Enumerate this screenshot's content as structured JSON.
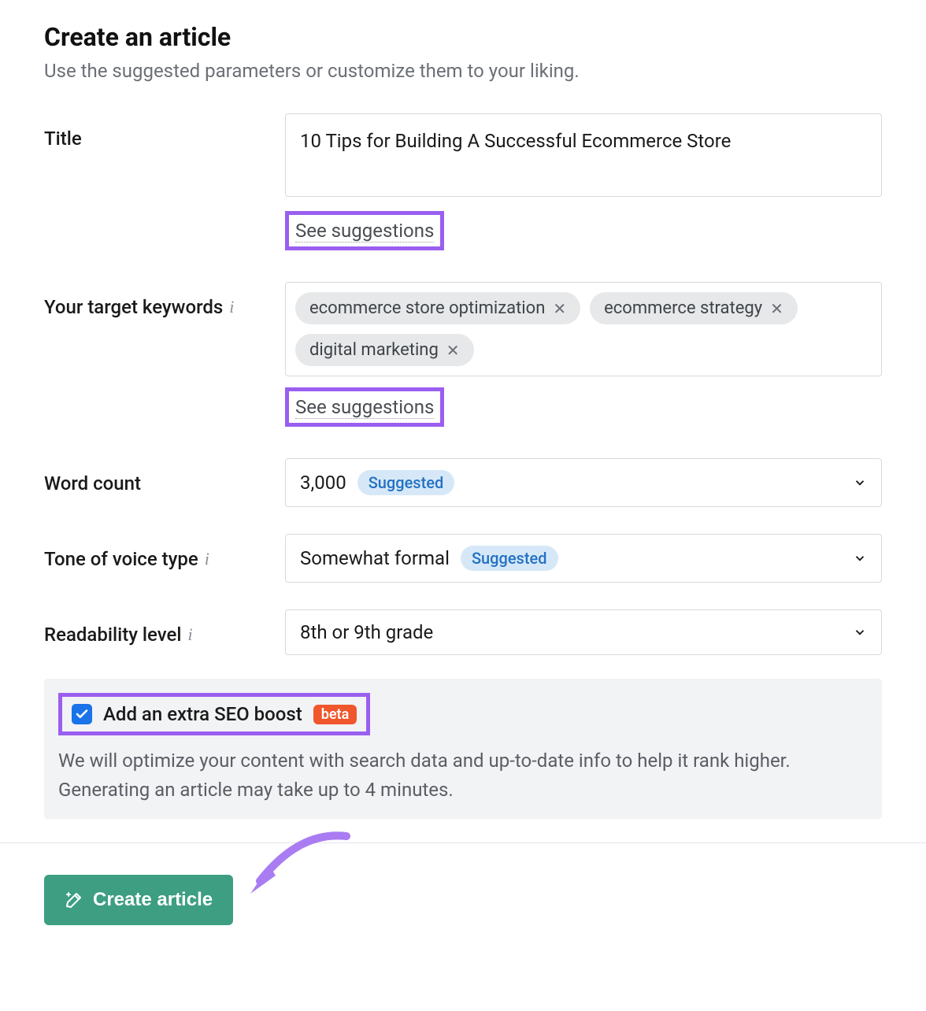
{
  "header": {
    "title": "Create an article",
    "subtitle": "Use the suggested parameters or customize them to your liking."
  },
  "form": {
    "title": {
      "label": "Title",
      "value": "10 Tips for Building A Successful Ecommerce Store",
      "see_suggestions": "See suggestions"
    },
    "keywords": {
      "label": "Your target keywords",
      "tags": [
        "ecommerce store optimization",
        "ecommerce strategy",
        "digital marketing"
      ],
      "see_suggestions": "See suggestions"
    },
    "word_count": {
      "label": "Word count",
      "value": "3,000",
      "badge": "Suggested"
    },
    "tone": {
      "label": "Tone of voice type",
      "value": "Somewhat formal",
      "badge": "Suggested"
    },
    "readability": {
      "label": "Readability level",
      "value": "8th or 9th grade"
    }
  },
  "seo": {
    "checkbox_checked": true,
    "label": "Add an extra SEO boost",
    "beta": "beta",
    "description": "We will optimize your content with search data and up-to-date info to help it rank higher. Generating an article may take up to 4 minutes."
  },
  "footer": {
    "create_button": "Create article"
  },
  "colors": {
    "highlight": "#9a5ff0",
    "primary_button": "#3d9e82",
    "beta": "#f0572c",
    "suggested_bg": "#d6e8f7",
    "suggested_fg": "#2371c4",
    "checkbox": "#1a73e8"
  }
}
